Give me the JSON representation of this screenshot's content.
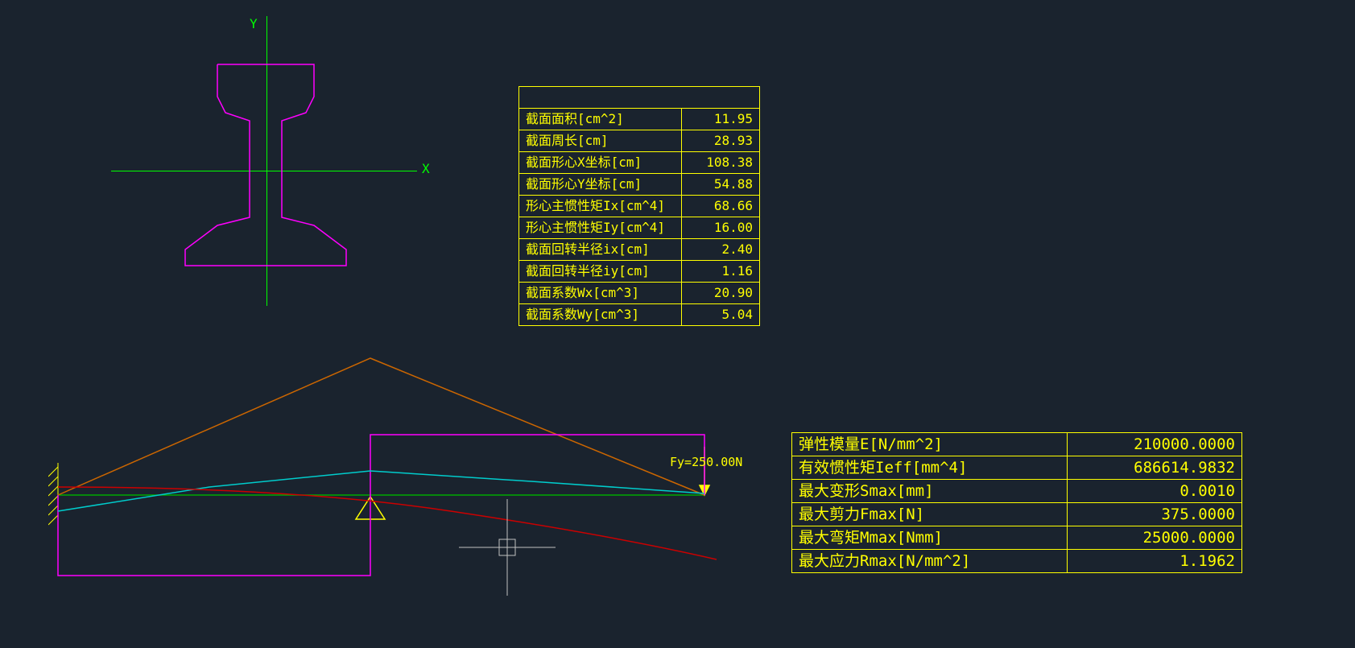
{
  "axes": {
    "x_label": "X",
    "y_label": "Y"
  },
  "section_table": {
    "rows": [
      {
        "label": "截面面积[cm^2]",
        "value": "11.95"
      },
      {
        "label": "截面周长[cm]",
        "value": "28.93"
      },
      {
        "label": "截面形心X坐标[cm]",
        "value": "108.38"
      },
      {
        "label": "截面形心Y坐标[cm]",
        "value": "54.88"
      },
      {
        "label": "形心主惯性矩Ix[cm^4]",
        "value": "68.66"
      },
      {
        "label": "形心主惯性矩Iy[cm^4]",
        "value": "16.00"
      },
      {
        "label": "截面回转半径ix[cm]",
        "value": "2.40"
      },
      {
        "label": "截面回转半径iy[cm]",
        "value": "1.16"
      },
      {
        "label": "截面系数Wx[cm^3]",
        "value": "20.90"
      },
      {
        "label": "截面系数Wy[cm^3]",
        "value": "5.04"
      }
    ]
  },
  "result_table": {
    "rows": [
      {
        "label": "弹性模量E[N/mm^2]",
        "value": "210000.0000"
      },
      {
        "label": "有效惯性矩Ieff[mm^4]",
        "value": "686614.9832"
      },
      {
        "label": "最大变形Smax[mm]",
        "value": "0.0010"
      },
      {
        "label": "最大剪力Fmax[N]",
        "value": "375.0000"
      },
      {
        "label": "最大弯矩Mmax[Nmm]",
        "value": "25000.0000"
      },
      {
        "label": "最大应力Rmax[N/mm^2]",
        "value": "1.1962"
      }
    ]
  },
  "beam": {
    "force_label": "Fy=250.00N"
  },
  "colors": {
    "axis": "#00ff00",
    "profile": "#ff00ff",
    "table": "#ffff00",
    "moment": "#cc6600",
    "shear": "#ff00ff",
    "defl": "#00cccc",
    "curve": "#cc0000",
    "beam": "#00aa00",
    "cursor": "#c0c0c0"
  },
  "chart_data": {
    "type": "engineering-diagram",
    "cross_section": {
      "shape": "rail",
      "area_cm2": 11.95,
      "perimeter_cm": 28.93,
      "centroid_x_cm": 108.38,
      "centroid_y_cm": 54.88,
      "Ix_cm4": 68.66,
      "Iy_cm4": 16.0,
      "ix_cm": 2.4,
      "iy_cm": 1.16,
      "Wx_cm3": 20.9,
      "Wy_cm3": 5.04
    },
    "beam_model": {
      "supports": [
        "fixed-left",
        "pin-mid"
      ],
      "load": {
        "type": "point",
        "Fy_N": 250.0,
        "location": "right-end"
      },
      "curves": [
        "moment(orange)",
        "shear(magenta-box)",
        "deflection(cyan)",
        "stress(red)"
      ]
    },
    "results": {
      "E_N_mm2": 210000.0,
      "Ieff_mm4": 686614.9832,
      "Smax_mm": 0.001,
      "Fmax_N": 375.0,
      "Mmax_Nmm": 25000.0,
      "Rmax_N_mm2": 1.1962
    }
  }
}
